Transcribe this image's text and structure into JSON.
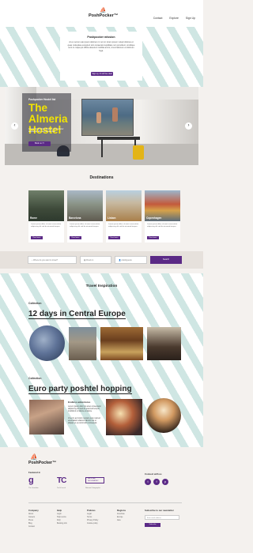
{
  "header": {
    "logo": "PoshPocker™",
    "nav": [
      "Contact",
      "Explore",
      "Sign Up"
    ]
  },
  "intro": {
    "title": "Poshpocker mission",
    "text": "At ex occum ate ipsum dolorem in non in lorem ipsum volupt dolores et quas molestias excepturi sint occaecati cupiditate non provident, similique sunt in culpa qui officia deserunt mollitia animi, id est laborum et dolorum fuga.",
    "button": "Sign up, it's all free deal"
  },
  "hero": {
    "label": "Poshpocker Hostel list",
    "title": "The Almeria Hostel",
    "subtitle": "Lorem ipsum dolor sit amet, consectetur adipiscing elit, sed do eiusmod.",
    "button": "Book ★ ☐",
    "prev": "‹",
    "next": "›"
  },
  "destinations": {
    "title": "Destinations",
    "cards": [
      {
        "name": "Rome",
        "text": "Lorem ipsum dolor sit amet consectetur adipiscing elit sed do eiusmod tempor",
        "button": "Read more"
      },
      {
        "name": "Barcelona",
        "text": "Lorem ipsum dolor sit amet consectetur adipiscing elit sed do eiusmod tempor",
        "button": "Read more"
      },
      {
        "name": "Lisbon",
        "text": "Lorem ipsum dolor sit amet consectetur adipiscing elit sed do eiusmod tempor",
        "button": "Read more"
      },
      {
        "name": "Copenhagen",
        "text": "Lorem ipsum dolor sit amet consectetur adipiscing elit sed do eiusmod tempor",
        "button": "Read more"
      }
    ]
  },
  "search": {
    "where": "⌕ Where do you want to travel?",
    "checkin": "▦ Check in",
    "guests": "👤 Adult/guests",
    "button": "Search"
  },
  "inspiration": {
    "title": "Travel Inspiration",
    "section1": {
      "label": "Collection",
      "title": "12 days in Central Europe"
    },
    "section2": {
      "label": "Collection",
      "title": "Euro party poshtel hopping",
      "para_title": "Endless adventures",
      "para1": "Lorem ipsum dolor sit amet consectetur adipiscing elit sed do eiusmod tempor incididunt ut labore et dolore.",
      "para2": "Ut enim ad minim veniam quis nostrud exercitation ullamco laboris nisi ut aliquip ex ea commodo consequat."
    }
  },
  "footer": {
    "logo": "PoshPocker™",
    "featured_head": "Featured in",
    "press": [
      {
        "mark": "g",
        "caption": "The Guardian"
      },
      {
        "mark": "TC",
        "caption": "TechCrunch"
      },
      {
        "mark": "NATIONAL GEOGRAPHIC",
        "caption": "National Geographic"
      }
    ],
    "connect_head": "Connect with us",
    "social": [
      "t",
      "f",
      "p"
    ],
    "cols": [
      {
        "head": "Company",
        "items": [
          "About",
          "Careers",
          "Press",
          "Blog",
          "Contact"
        ]
      },
      {
        "head": "Help",
        "items": [
          "Login",
          "Help centre",
          "FAQ",
          "Booking info"
        ]
      },
      {
        "head": "Policies",
        "items": [
          "Legal",
          "Terms",
          "Privacy Policy",
          "Cookie policy"
        ]
      },
      {
        "head": "Regions",
        "items": [
          "Americas",
          "Europe",
          "Asia"
        ]
      },
      {
        "head": "Subscribe to our newsletter",
        "items": []
      }
    ],
    "newsletter_placeholder": "Enter email address",
    "newsletter_button": "Subscribe"
  }
}
